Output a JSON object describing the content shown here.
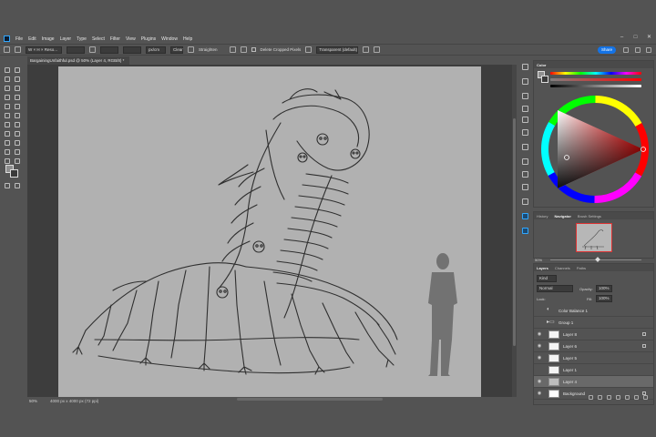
{
  "app": {
    "menu": [
      "File",
      "Edit",
      "Image",
      "Layer",
      "Type",
      "Select",
      "Filter",
      "View",
      "Plugins",
      "Window",
      "Help"
    ]
  },
  "options": {
    "size_field": "W × H × Reso...",
    "units_field": "px/cm",
    "clear_label": "Clear",
    "straighten_label": "Straighten",
    "delete_cropped_label": "Delete Cropped Pixels",
    "fill_value": "Transparent (default)",
    "share_label": "Share"
  },
  "document": {
    "tab_title": "BargainingUnfaithful.psd @ 50% (Layer 4, RGB/8) *",
    "zoom": "50%",
    "doc_info": "4000 px x 4000 px (72 ppi)"
  },
  "colors": {
    "accent": "#1473e6",
    "canvas_bg": "#b1b1b1",
    "sketch_line": "#2f2f2f"
  },
  "panels": {
    "color": {
      "tab": "Color"
    },
    "navigator": {
      "tabs": [
        "History",
        "Navigator",
        "Brush Settings"
      ],
      "active": "Navigator",
      "zoom": "50%"
    },
    "layers": {
      "tabs": [
        "Layers",
        "Channels",
        "Paths"
      ],
      "active": "Layers",
      "filter": "Kind",
      "blend_mode": "Normal",
      "opacity_label": "Opacity:",
      "opacity_value": "100%",
      "lock_label": "Lock:",
      "fill_label": "Fill:",
      "fill_value": "100%",
      "items": [
        {
          "name": "Color Balance 1",
          "type": "adjustment",
          "visible": false
        },
        {
          "name": "Group 1",
          "type": "group",
          "visible": false
        },
        {
          "name": "Layer 8",
          "type": "layer",
          "visible": true
        },
        {
          "name": "Layer 6",
          "type": "layer",
          "visible": true
        },
        {
          "name": "Layer 5",
          "type": "layer",
          "visible": true
        },
        {
          "name": "Layer 1",
          "type": "layer",
          "visible": false
        },
        {
          "name": "Layer 4",
          "type": "layer",
          "visible": true,
          "selected": true
        },
        {
          "name": "Background",
          "type": "layer",
          "visible": true
        }
      ]
    }
  }
}
